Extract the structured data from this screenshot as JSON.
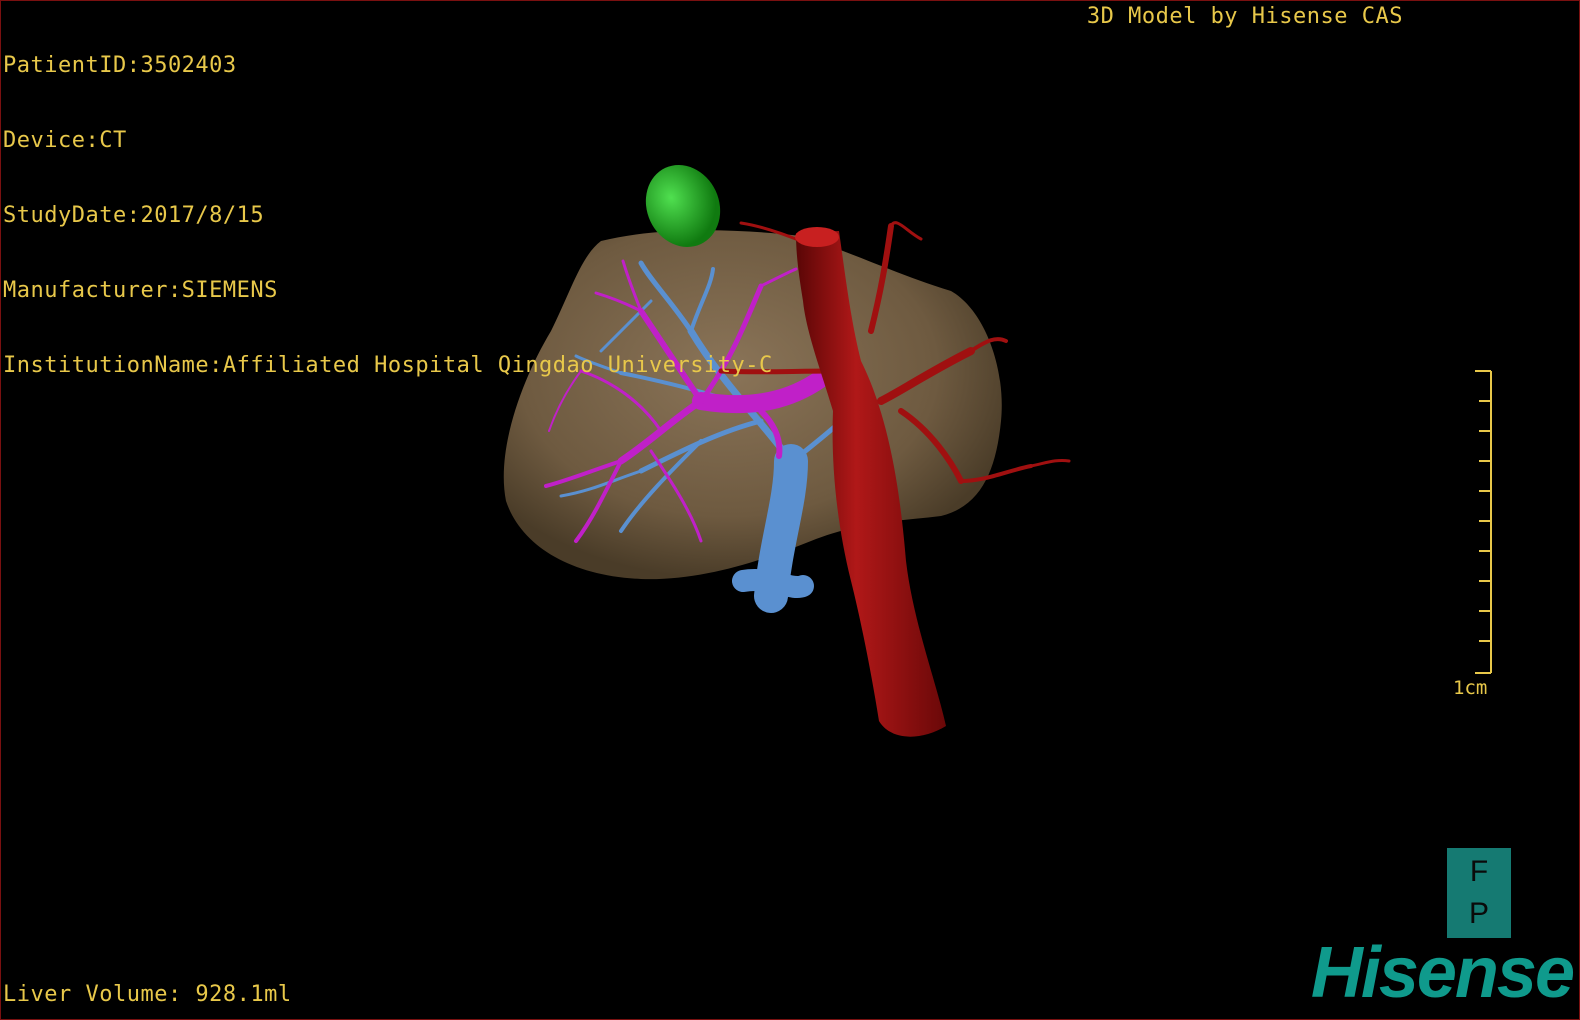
{
  "metadata": {
    "patient_id": "PatientID:3502403",
    "device": "Device:CT",
    "study_date": "StudyDate:2017/8/15",
    "manufacturer": "Manufacturer:SIEMENS",
    "institution": "InstitutionName:Affiliated Hospital Qingdao University-C"
  },
  "model_credit": "3D Model by Hisense CAS",
  "liver_volume": "Liver Volume: 928.1ml",
  "scale": {
    "label": "1cm"
  },
  "orientation": {
    "top": "F",
    "bottom": "P"
  },
  "brand": "Hisense",
  "colors": {
    "overlay_text": "#e8c84a",
    "liver": "#7a6448",
    "artery": "#a01010",
    "portal_vein": "#c020c8",
    "hepatic_vein": "#5a90d0",
    "gallbladder": "#20b020",
    "brand": "#0f9a8c",
    "border": "#7a1010"
  }
}
